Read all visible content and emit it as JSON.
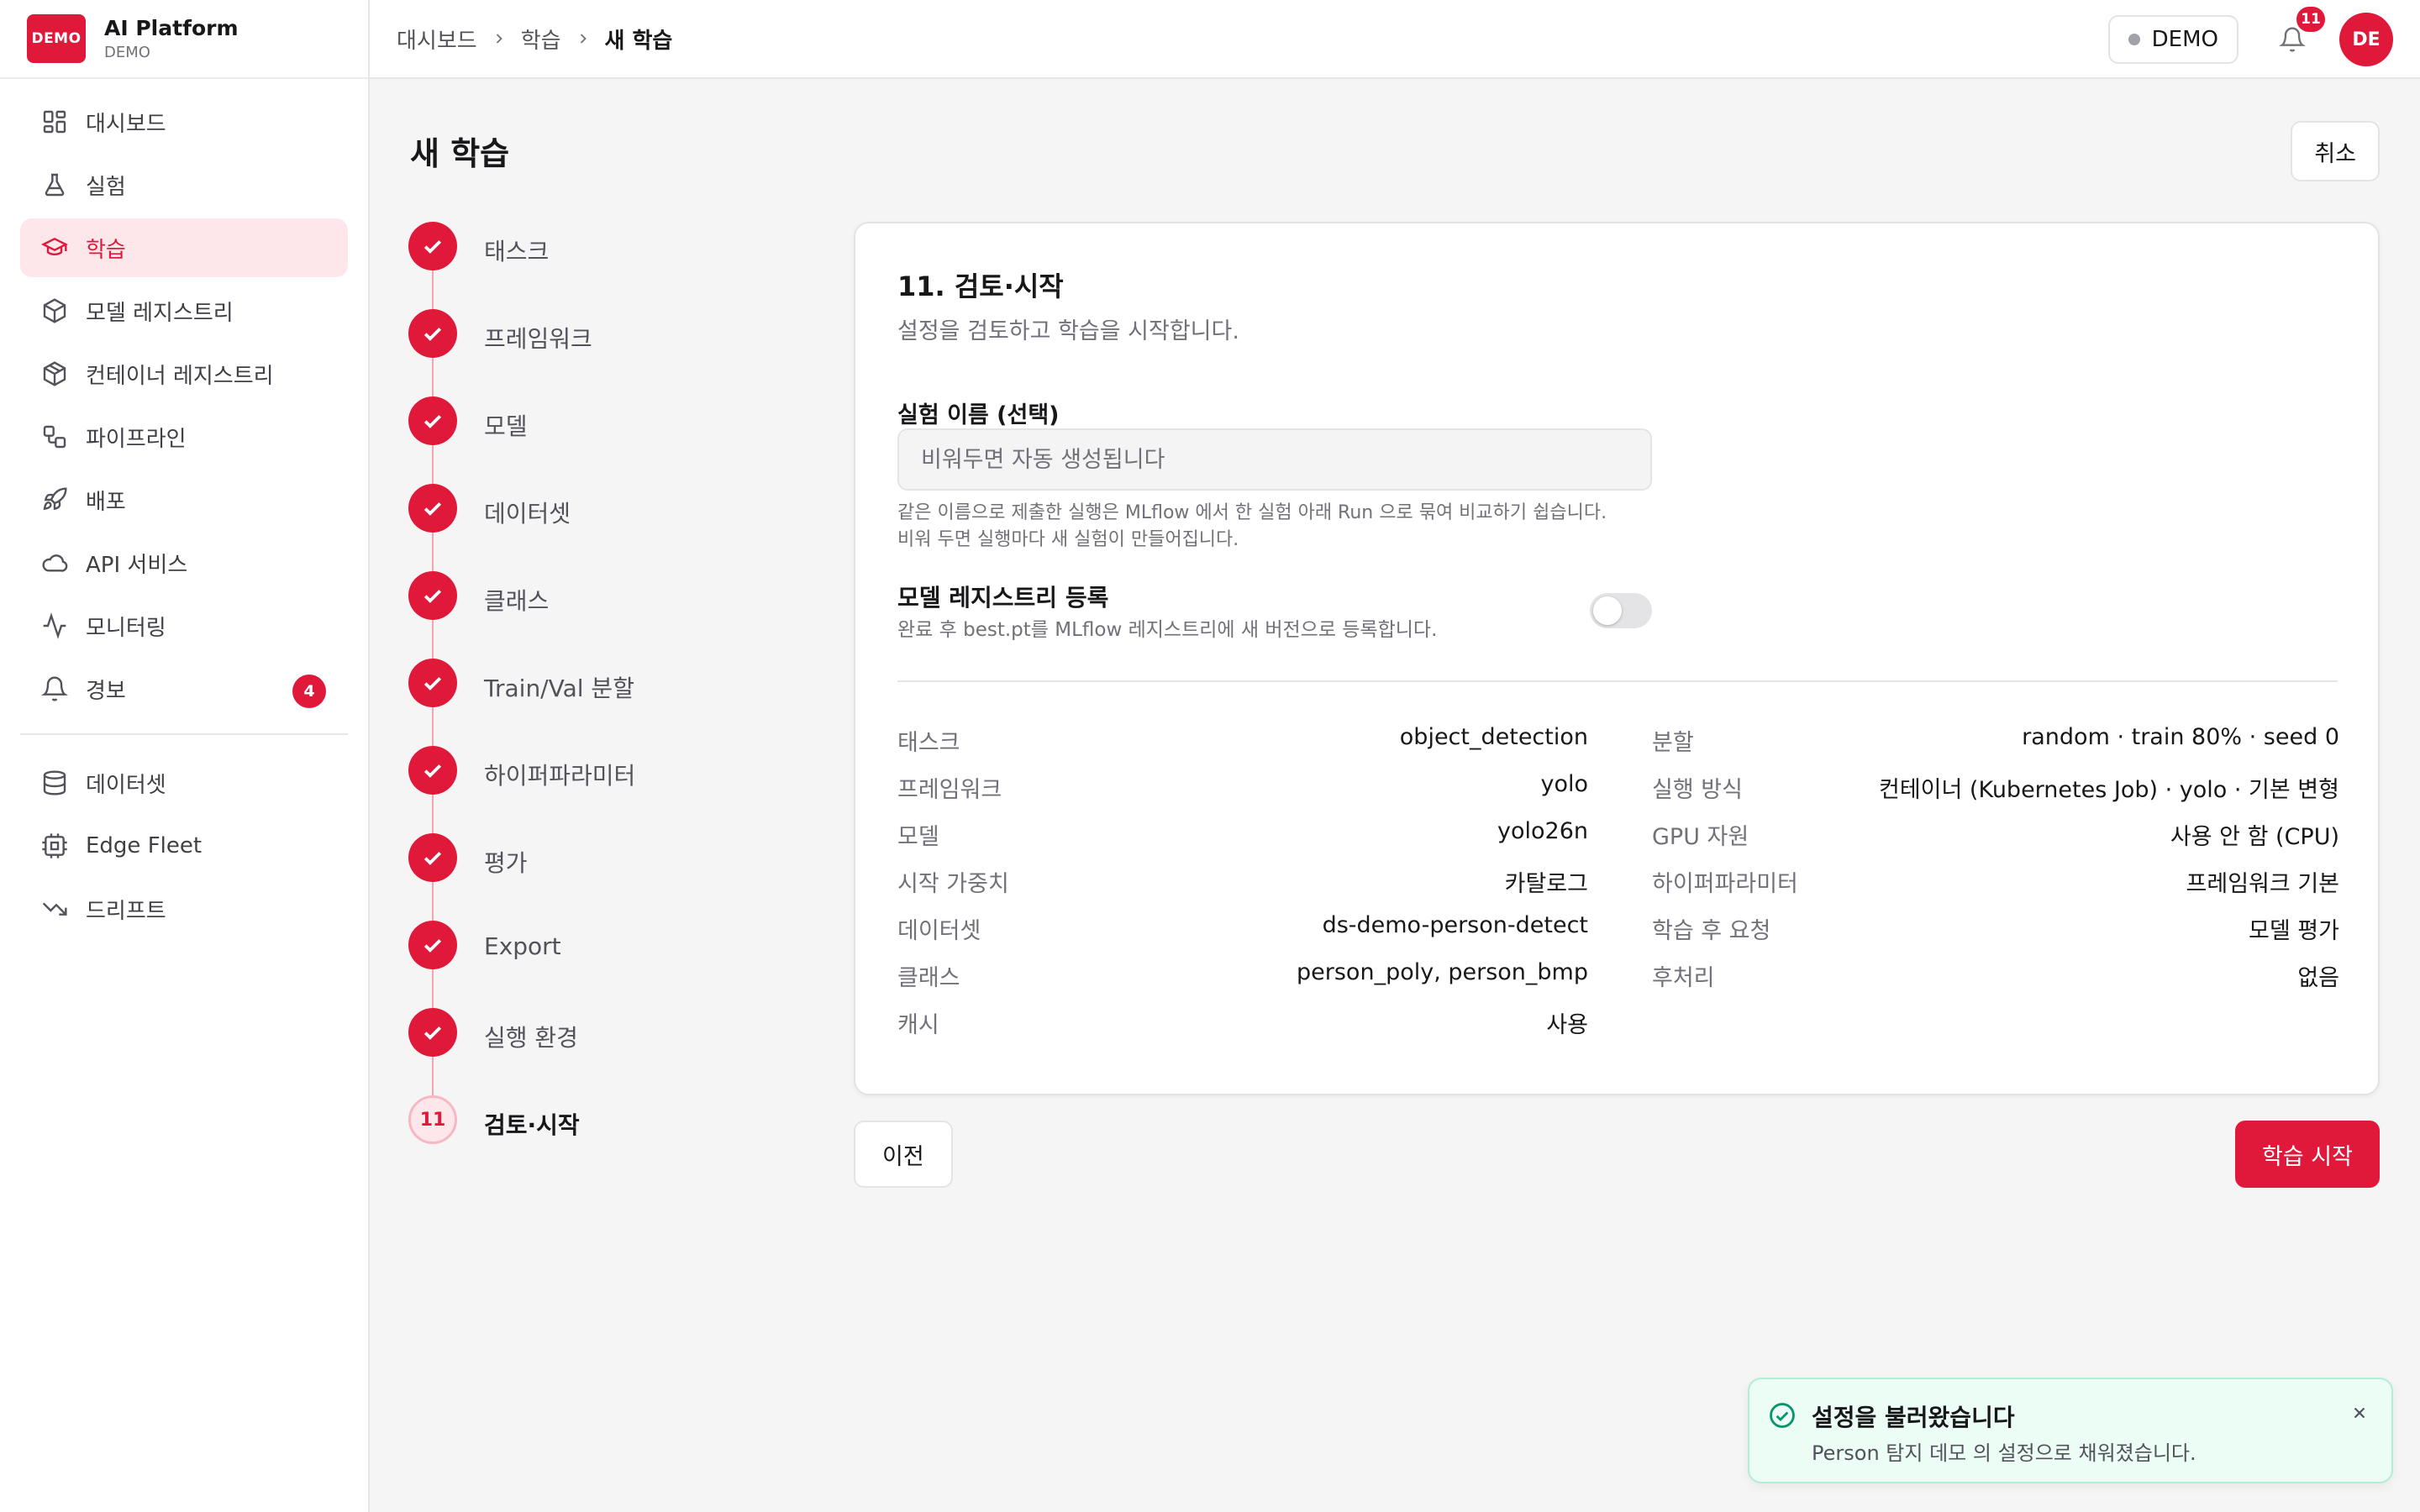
{
  "brand": {
    "logo_text": "DEMO",
    "name": "AI Platform",
    "subtitle": "DEMO",
    "accent_color": "#e0193a"
  },
  "sidebar": {
    "items": [
      {
        "label": "대시보드",
        "icon": "dashboard-icon"
      },
      {
        "label": "실험",
        "icon": "flask-icon"
      },
      {
        "label": "학습",
        "icon": "graduation-cap-icon",
        "active": true
      },
      {
        "label": "모델 레지스트리",
        "icon": "cube-icon"
      },
      {
        "label": "컨테이너 레지스트리",
        "icon": "boxes-icon"
      },
      {
        "label": "파이프라인",
        "icon": "workflow-icon"
      },
      {
        "label": "배포",
        "icon": "rocket-icon"
      },
      {
        "label": "API 서비스",
        "icon": "cloud-icon"
      },
      {
        "label": "모니터링",
        "icon": "activity-icon"
      },
      {
        "label": "경보",
        "icon": "bell-icon",
        "badge": "4"
      }
    ],
    "secondary_items": [
      {
        "label": "데이터셋",
        "icon": "database-icon"
      },
      {
        "label": "Edge Fleet",
        "icon": "device-icon"
      },
      {
        "label": "드리프트",
        "icon": "trending-down-icon"
      }
    ]
  },
  "header": {
    "breadcrumb": [
      "대시보드",
      "학습",
      "새 학습"
    ],
    "env_label": "DEMO",
    "notification_count": "11",
    "avatar_initials": "DE"
  },
  "page": {
    "title": "새 학습",
    "cancel_label": "취소"
  },
  "steps": [
    {
      "label": "태스크",
      "done": true
    },
    {
      "label": "프레임워크",
      "done": true
    },
    {
      "label": "모델",
      "done": true
    },
    {
      "label": "데이터셋",
      "done": true
    },
    {
      "label": "클래스",
      "done": true
    },
    {
      "label": "Train/Val 분할",
      "done": true
    },
    {
      "label": "하이퍼파라미터",
      "done": true
    },
    {
      "label": "평가",
      "done": true
    },
    {
      "label": "Export",
      "done": true
    },
    {
      "label": "실행 환경",
      "done": true
    },
    {
      "label": "검토·시작",
      "number": "11",
      "current": true
    }
  ],
  "review": {
    "title": "11. 검토·시작",
    "description": "설정을 검토하고 학습을 시작합니다.",
    "experiment_name_label": "실험 이름 (선택)",
    "experiment_name_placeholder": "비워두면 자동 생성됩니다",
    "experiment_name_value": "",
    "help_line1": "같은 이름으로 제출한 실행은 MLflow 에서 한 실험 아래 Run 으로 묶여 비교하기 쉽습니다.",
    "help_line2": "비워 두면 실행마다 새 실험이 만들어집니다.",
    "registry_label": "모델 레지스트리 등록",
    "registry_help": "완료 후 best.pt를 MLflow 레지스트리에 새 버전으로 등록합니다.",
    "registry_enabled": false,
    "summary_left": [
      {
        "key": "태스크",
        "value": "object_detection"
      },
      {
        "key": "프레임워크",
        "value": "yolo"
      },
      {
        "key": "모델",
        "value": "yolo26n"
      },
      {
        "key": "시작 가중치",
        "value": "카탈로그"
      },
      {
        "key": "데이터셋",
        "value": "ds-demo-person-detect"
      },
      {
        "key": "클래스",
        "value": "person_poly, person_bmp"
      },
      {
        "key": "캐시",
        "value": "사용"
      }
    ],
    "summary_right": [
      {
        "key": "분할",
        "value": "random · train 80% · seed 0"
      },
      {
        "key": "실행 방식",
        "value": "컨테이너 (Kubernetes Job) · yolo · 기본 변형"
      },
      {
        "key": "GPU 자원",
        "value": "사용 안 함 (CPU)"
      },
      {
        "key": "하이퍼파라미터",
        "value": "프레임워크 기본"
      },
      {
        "key": "학습 후 요청",
        "value": "모델 평가"
      },
      {
        "key": "후처리",
        "value": "없음"
      }
    ]
  },
  "actions": {
    "prev_label": "이전",
    "start_label": "학습 시작"
  },
  "toast": {
    "title": "설정을 불러왔습니다",
    "message": "Person 탐지 데모 의 설정으로 채워졌습니다.",
    "icon": "check-circle-icon"
  }
}
